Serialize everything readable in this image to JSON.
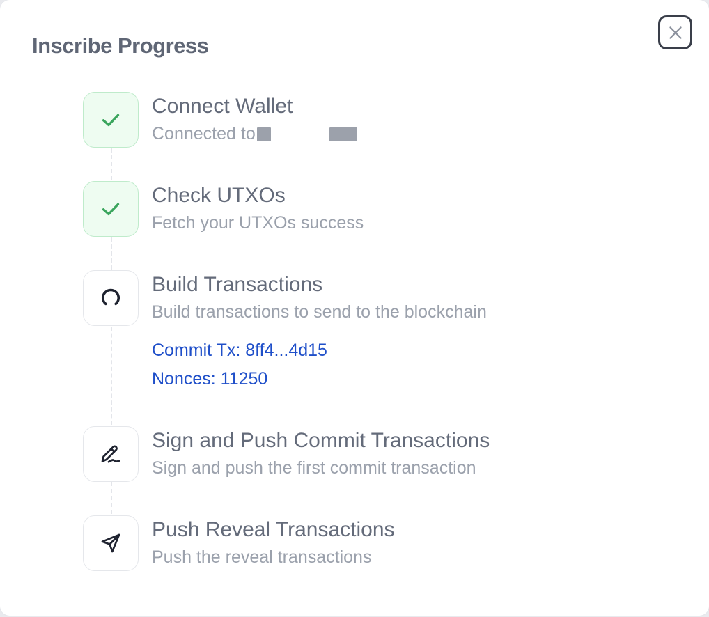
{
  "dialog": {
    "title": "Inscribe Progress",
    "close_icon": "close-icon"
  },
  "steps": [
    {
      "title": "Connect Wallet",
      "description": "Connected to",
      "status": "done",
      "icon": "check-icon"
    },
    {
      "title": "Check UTXOs",
      "description": "Fetch your UTXOs success",
      "status": "done",
      "icon": "check-icon"
    },
    {
      "title": "Build Transactions",
      "description": "Build transactions to send to the blockchain",
      "status": "in-progress",
      "icon": "spinner-icon",
      "details": {
        "commit_tx": "Commit Tx: 8ff4...4d15",
        "nonces": "Nonces: 11250"
      }
    },
    {
      "title": "Sign and Push Commit Transactions",
      "description": "Sign and push the first commit transaction",
      "status": "pending",
      "icon": "signature-icon"
    },
    {
      "title": "Push Reveal Transactions",
      "description": "Push the reveal transactions",
      "status": "pending",
      "icon": "send-icon"
    }
  ],
  "colors": {
    "success": "#3aa55d",
    "success_bg": "#eefcf1",
    "link": "#1f4fc9",
    "title_text": "#5f6675",
    "muted_text": "#9ba1ac"
  }
}
